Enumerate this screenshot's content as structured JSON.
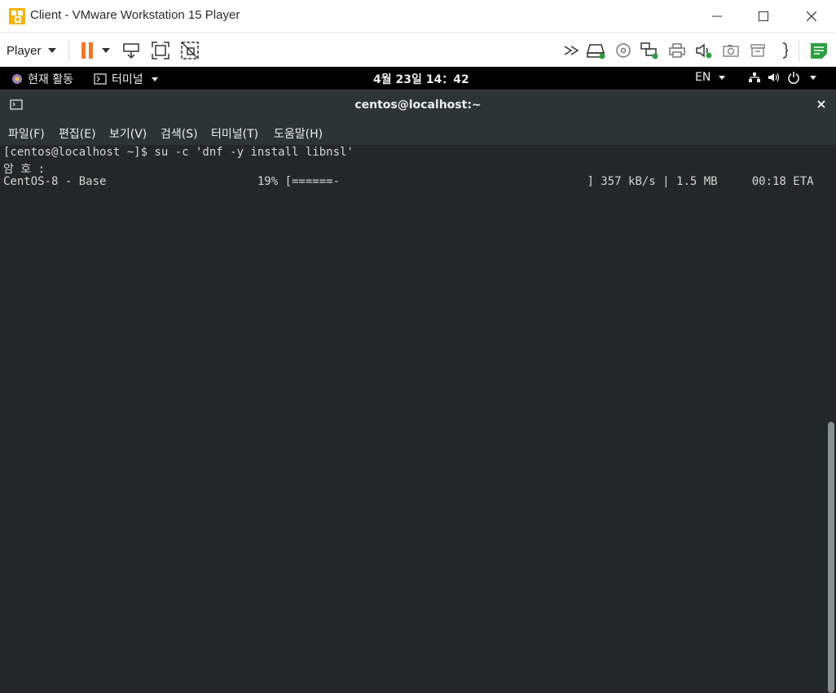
{
  "window": {
    "title": "Client - VMware Workstation 15 Player"
  },
  "toolbar": {
    "player_label": "Player",
    "icons": [
      "pause-icon",
      "dropdown-caret-icon",
      "send-ctrl-alt-del-icon",
      "full-screen-icon",
      "unity-icon",
      "forward-icon",
      "hard-disk-icon",
      "cd-dvd-icon",
      "network-adapter-icon",
      "printer-icon",
      "sound-card-icon",
      "camera-icon",
      "usb-icon",
      "more-icon",
      "message-log-icon"
    ],
    "pause_color": "#f0782a",
    "accent_green": "#2ea043"
  },
  "gnome": {
    "activities": "현재 활동",
    "terminal_menu": "터미널",
    "clock": "4월 23일 14：42",
    "input_lang": "EN"
  },
  "terminal": {
    "title": "centos@localhost:~",
    "close": "×",
    "menu": [
      "파일(F)",
      "편집(E)",
      "보기(V)",
      "검색(S)",
      "터미널(T)",
      "도움말(H)"
    ],
    "lines": [
      "[centos@localhost ~]$ su -c 'dnf -y install libnsl'",
      "암 호 :",
      "CentOS-8 - Base                      19% [======-                                    ] 357 kB/s | 1.5 MB     00:18 ETA"
    ],
    "background": "#232728",
    "foreground": "#d6d6d6"
  }
}
